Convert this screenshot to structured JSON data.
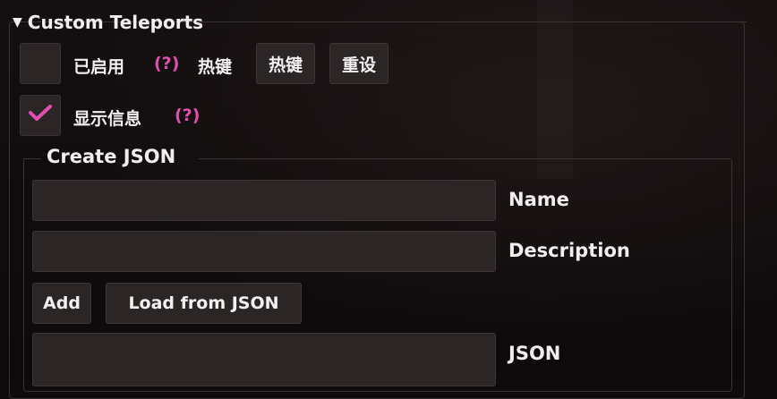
{
  "section": {
    "title": "Custom Teleports",
    "expand_icon": "triangle-down-icon"
  },
  "enabled_row": {
    "enabled_label": "已启用",
    "help_text": "(?)",
    "hotkey_label": "热键",
    "hotkey_button": "热键",
    "reset_button": "重设",
    "checked": false
  },
  "info_row": {
    "label": "显示信息",
    "help_text": "(?)",
    "checked": true
  },
  "create_json": {
    "title": "Create JSON",
    "name_value": "",
    "name_label": "Name",
    "description_value": "",
    "description_label": "Description",
    "add_button": "Add",
    "load_button": "Load from JSON",
    "json_value": "",
    "json_label": "JSON"
  },
  "colors": {
    "accent": "#e24fb0",
    "control_bg": "#2b2526",
    "background": "#0f0b0c"
  }
}
